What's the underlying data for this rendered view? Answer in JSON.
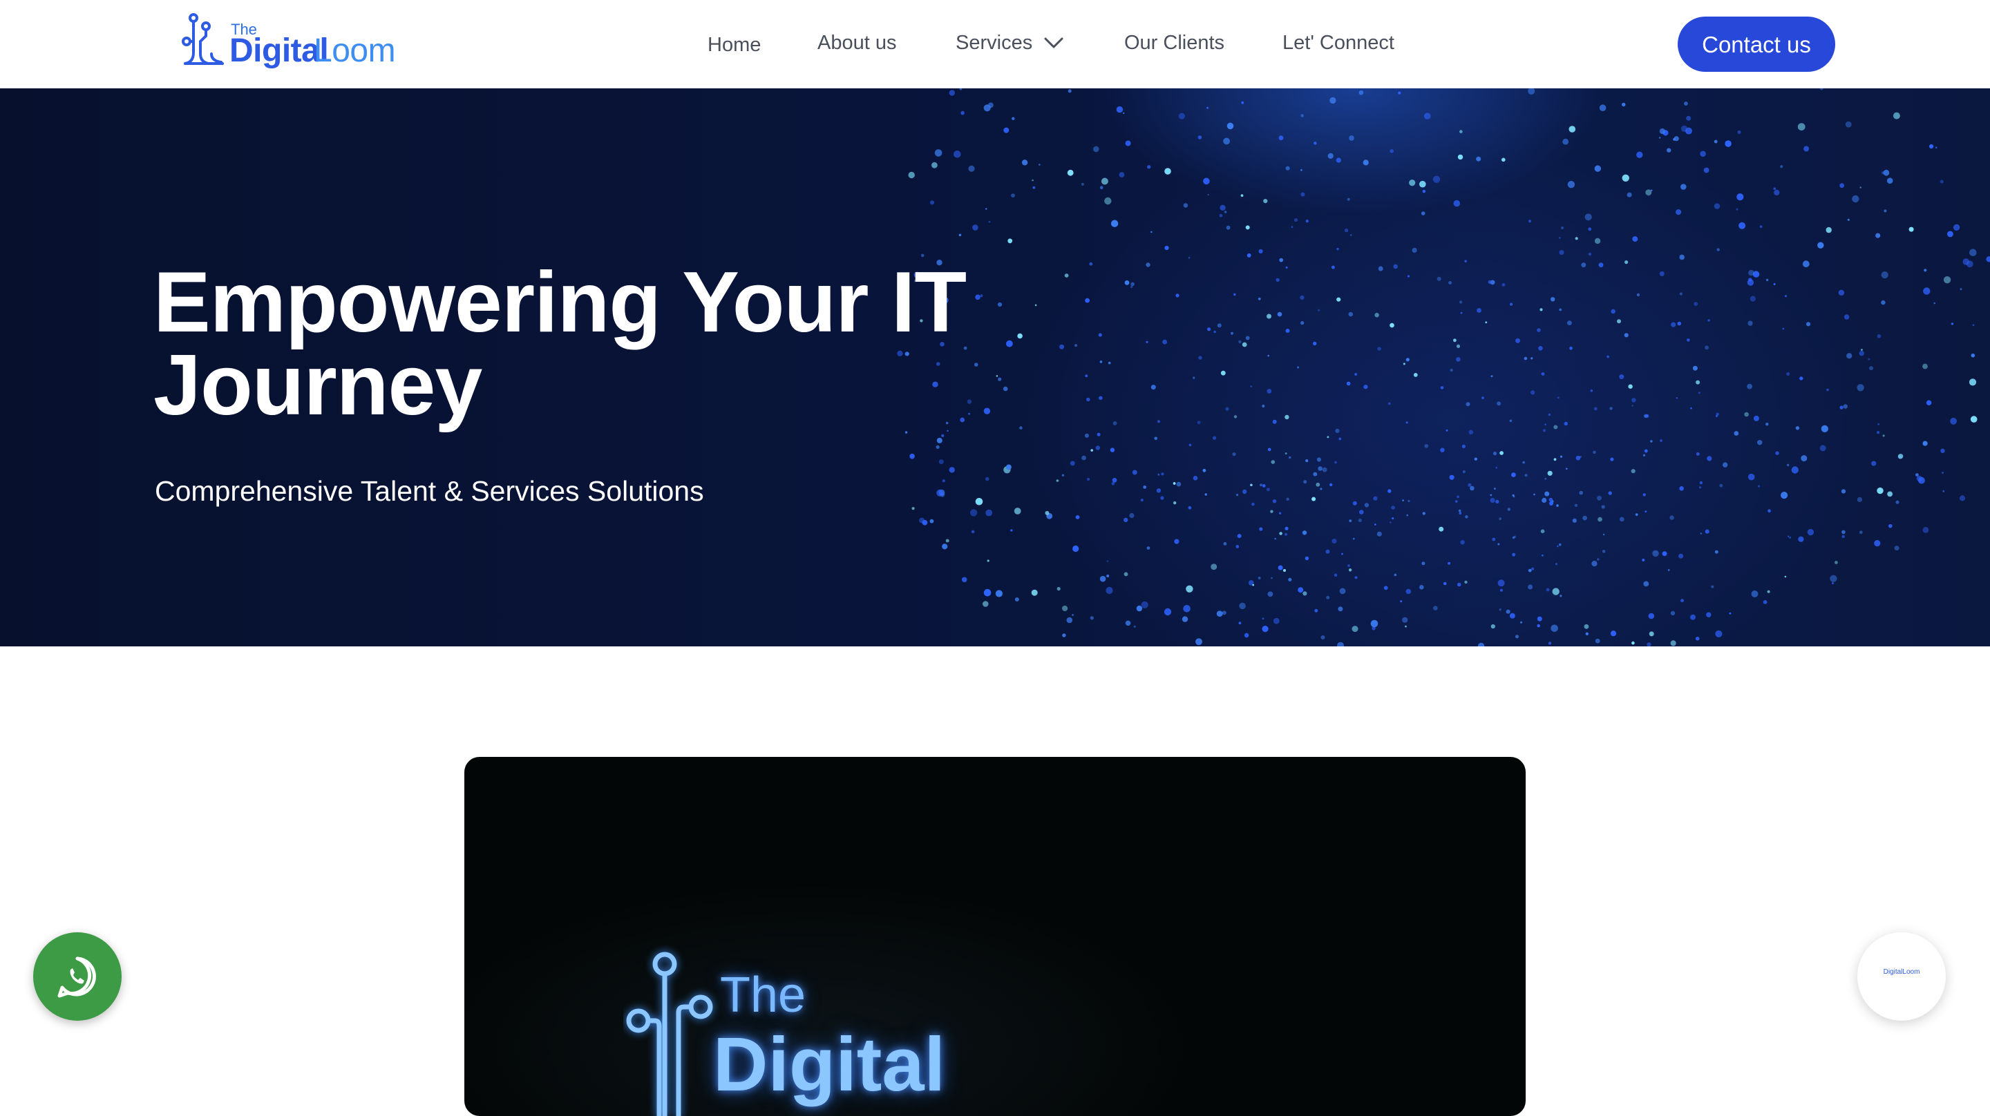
{
  "header": {
    "logo": {
      "the": "The",
      "digital": "Digital",
      "loom": "Loom"
    },
    "nav": [
      {
        "label": "Home"
      },
      {
        "label": "About us"
      },
      {
        "label": "Services"
      },
      {
        "label": "Our Clients"
      },
      {
        "label": "Let' Connect"
      }
    ],
    "services_icon": "chevron-down-icon",
    "contact_label": "Contact us"
  },
  "hero": {
    "title": "Empowering Your IT Journey",
    "subtitle": "Comprehensive Talent & Services Solutions"
  },
  "video": {
    "logo_the": "The",
    "logo_digital": "Digital"
  },
  "floating": {
    "whatsapp_icon": "whatsapp-icon",
    "chat_widget_label": "DigitalLoom"
  },
  "colors": {
    "brand_blue": "#2748d8",
    "hero_bg": "#07112e",
    "whatsapp_green": "#3d9a45",
    "nav_text": "#4a4f5c"
  }
}
